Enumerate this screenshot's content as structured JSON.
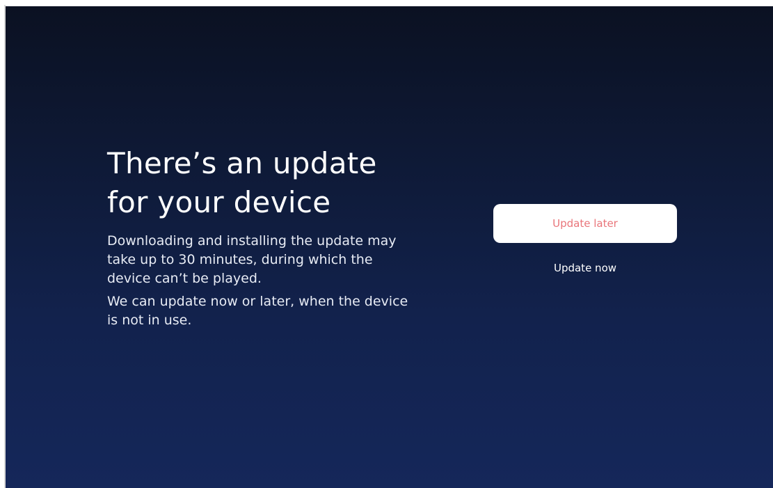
{
  "update_prompt": {
    "headline_line1": "There’s an update",
    "headline_line2": "for your device",
    "body_paragraph1_line1": "Downloading and installing the update may",
    "body_paragraph1_line2": "take up to 30  minutes, during which the",
    "body_paragraph1_line3": "device can’t be played.",
    "body_paragraph2_line1": "We can update now or later, when the device",
    "body_paragraph2_line2": "is not in use."
  },
  "actions": {
    "update_later_label": "Update later",
    "update_now_label": "Update now"
  },
  "colors": {
    "background_top": "#0b1122",
    "background_bottom": "#15275a",
    "primary_button_bg": "#ffffff",
    "primary_button_text": "#e9757a",
    "text": "#ffffff"
  }
}
